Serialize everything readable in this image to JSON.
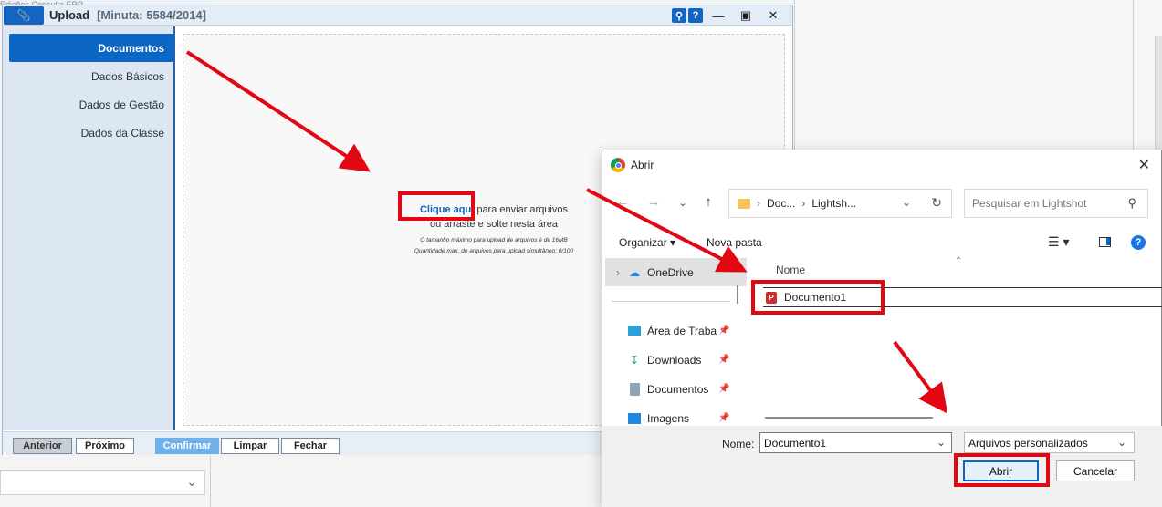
{
  "background": {
    "topbar_text": "Edições    Consulta ERP"
  },
  "upload_window": {
    "title": "Upload",
    "subtitle": "[Minuta: 5584/2014]",
    "icons": [
      "paperclip-icon",
      "search-icon",
      "help-icon",
      "minimize-icon",
      "maximize-icon",
      "close-icon"
    ],
    "help_label": "?",
    "sidebar": [
      {
        "label": "Documentos",
        "active": true
      },
      {
        "label": "Dados Básicos",
        "active": false
      },
      {
        "label": "Dados de Gestão",
        "active": false
      },
      {
        "label": "Dados da Classe",
        "active": false
      }
    ],
    "dropzone": {
      "link_text": "Clique aqui",
      "line1_rest": " para enviar arquivos",
      "line2": "ou arraste e solte nesta área",
      "limit_size": "O tamanho máximo para upload de arquivos é de 16MB",
      "limit_count": "Quantidade max. de arquivos para upload simultâneo: 0/100"
    },
    "footer": {
      "anterior": "Anterior",
      "proximo": "Próximo",
      "confirmar": "Confirmar",
      "limpar": "Limpar",
      "fechar": "Fechar"
    }
  },
  "dialog": {
    "title": "Abrir",
    "address": {
      "part1": "Doc...",
      "part2": "Lightsh..."
    },
    "search_placeholder": "Pesquisar em Lightshot",
    "toolbar": {
      "organize": "Organizar",
      "new_folder": "Nova pasta"
    },
    "tree": [
      {
        "label": "OneDrive",
        "icon": "cloud-icon",
        "pinned": false,
        "selected": true
      },
      {
        "label": "Área de Traba",
        "icon": "desktop-icon",
        "pinned": true
      },
      {
        "label": "Downloads",
        "icon": "download-icon",
        "pinned": true
      },
      {
        "label": "Documentos",
        "icon": "documents-icon",
        "pinned": true
      },
      {
        "label": "Imagens",
        "icon": "images-icon",
        "pinned": true
      }
    ],
    "column_header": "Nome",
    "files": [
      {
        "name": "Documento1",
        "icon": "pdf-icon"
      }
    ],
    "filename_label": "Nome:",
    "filename_value": "Documento1",
    "filetype_value": "Arquivos personalizados",
    "open_button": "Abrir",
    "cancel_button": "Cancelar"
  },
  "annotation_color": "#e30613"
}
